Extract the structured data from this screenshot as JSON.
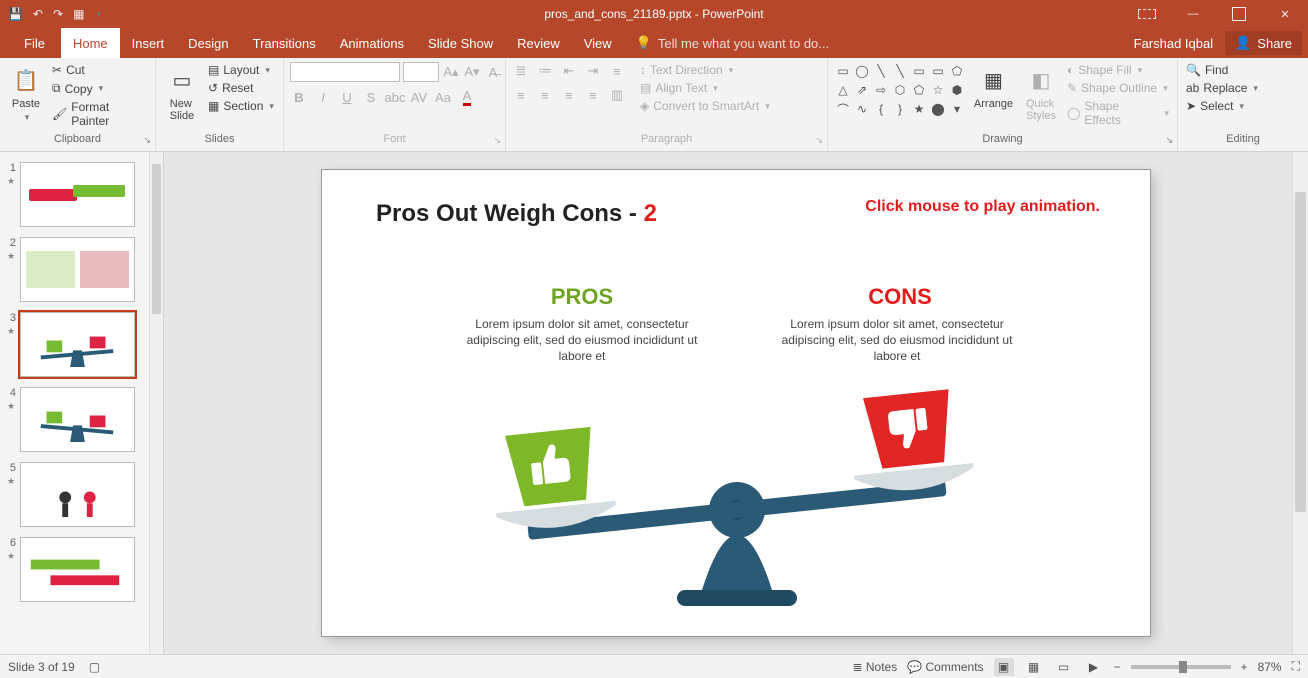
{
  "window": {
    "title": "pros_and_cons_21189.pptx - PowerPoint",
    "user": "Farshad Iqbal",
    "share": "Share"
  },
  "tabs": {
    "file": "File",
    "home": "Home",
    "insert": "Insert",
    "design": "Design",
    "transitions": "Transitions",
    "animations": "Animations",
    "slideshow": "Slide Show",
    "review": "Review",
    "view": "View",
    "tell": "Tell me what you want to do..."
  },
  "ribbon": {
    "clipboard": {
      "label": "Clipboard",
      "paste": "Paste",
      "cut": "Cut",
      "copy": "Copy",
      "format_painter": "Format Painter"
    },
    "slides": {
      "label": "Slides",
      "new_slide": "New\nSlide",
      "layout": "Layout",
      "reset": "Reset",
      "section": "Section"
    },
    "font": {
      "label": "Font"
    },
    "paragraph": {
      "label": "Paragraph",
      "text_direction": "Text Direction",
      "align_text": "Align Text",
      "convert_smartart": "Convert to SmartArt"
    },
    "drawing": {
      "label": "Drawing",
      "arrange": "Arrange",
      "quick_styles": "Quick\nStyles",
      "shape_fill": "Shape Fill",
      "shape_outline": "Shape Outline",
      "shape_effects": "Shape Effects"
    },
    "editing": {
      "label": "Editing",
      "find": "Find",
      "replace": "Replace",
      "select": "Select"
    }
  },
  "slide": {
    "title_a": "Pros Out Weigh Cons - ",
    "title_b": "2",
    "hint": "Click mouse to play animation.",
    "pros_head": "PROS",
    "cons_head": "CONS",
    "lorem": "Lorem ipsum dolor sit amet, consectetur adipiscing elit, sed do eiusmod incididunt ut labore et",
    "colors": {
      "pros": "#7eb728",
      "cons": "#e22525",
      "scale": "#2a5a75",
      "scale_dark": "#204a60",
      "pan": "#d6dde1"
    }
  },
  "status": {
    "slide_of": "Slide 3 of 19",
    "notes": "Notes",
    "comments": "Comments",
    "zoom": "87%"
  },
  "thumbs": [
    "1",
    "2",
    "3",
    "4",
    "5",
    "6"
  ]
}
